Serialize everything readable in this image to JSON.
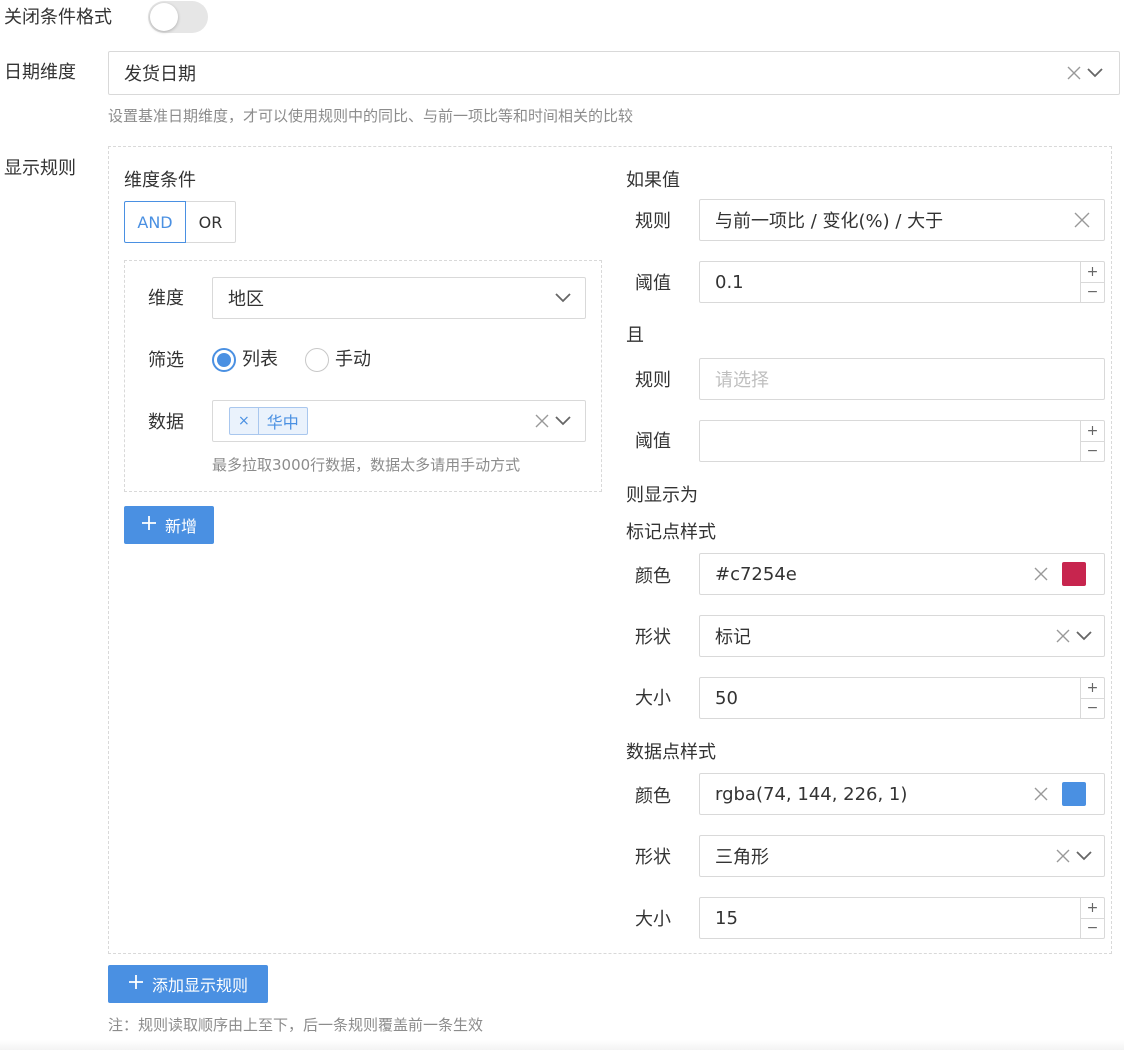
{
  "header": {
    "toggle_label": "关闭条件格式"
  },
  "date_dim": {
    "label": "日期维度",
    "value": "发货日期",
    "hint": "设置基准日期维度，才可以使用规则中的同比、与前一项比等和时间相关的比较"
  },
  "rules_section": {
    "label": "显示规则"
  },
  "dim_condition": {
    "title": "维度条件",
    "and_label": "AND",
    "or_label": "OR",
    "dimension_label": "维度",
    "dimension_value": "地区",
    "filter_label": "筛选",
    "radio_list": "列表",
    "radio_manual": "手动",
    "data_label": "数据",
    "tag_value": "华中",
    "tag_close": "×",
    "hint": "最多拉取3000行数据，数据太多请用手动方式",
    "add_label": "新增"
  },
  "if_value": {
    "title": "如果值",
    "rule_label": "规则",
    "rule_value": "与前一项比 / 变化(%) / 大于",
    "threshold_label": "阈值",
    "threshold_value": "0.1"
  },
  "and_cond": {
    "title": "且",
    "rule_label": "规则",
    "rule_placeholder": "请选择",
    "threshold_label": "阈值",
    "threshold_value": ""
  },
  "display": {
    "title": "则显示为"
  },
  "marker_style": {
    "title": "标记点样式",
    "color_label": "颜色",
    "color_value": "#c7254e",
    "swatch": "#c7254e",
    "shape_label": "形状",
    "shape_value": "标记",
    "size_label": "大小",
    "size_value": "50"
  },
  "datapoint_style": {
    "title": "数据点样式",
    "color_label": "颜色",
    "color_value": "rgba(74, 144, 226, 1)",
    "swatch": "#4a90e2",
    "shape_label": "形状",
    "shape_value": "三角形",
    "size_label": "大小",
    "size_value": "15"
  },
  "footer": {
    "add_rule_label": "添加显示规则",
    "note": "注：规则读取顺序由上至下，后一条规则覆盖前一条生效"
  },
  "stepper": {
    "plus": "+",
    "minus": "−"
  },
  "colors": {
    "accent": "#4a90e2"
  }
}
